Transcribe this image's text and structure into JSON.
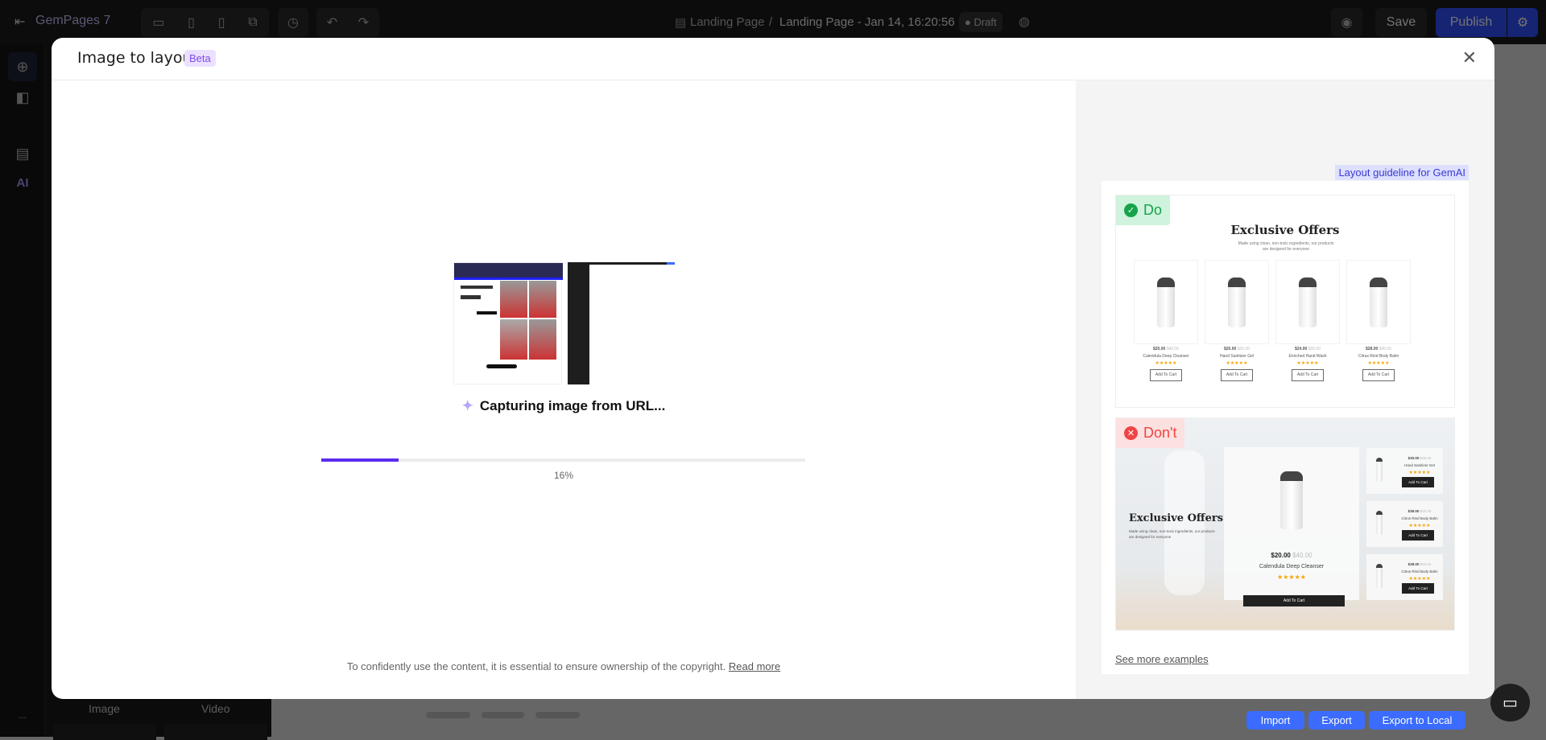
{
  "topbar": {
    "app_name": "GemPages 7",
    "breadcrumb_parent": "Landing Page",
    "breadcrumb_sep": "/",
    "page_name": "Landing Page - Jan 14, 16:20:56",
    "status": "Draft",
    "save": "Save",
    "publish": "Publish"
  },
  "sidebar": {
    "ai_label": "AI",
    "more": "..."
  },
  "leftpanel": {
    "items": [
      "Image",
      "Video"
    ]
  },
  "bottom": {
    "import": "Import",
    "export": "Export",
    "export_local": "Export to Local"
  },
  "modal": {
    "title": "Image to layout",
    "badge": "Beta",
    "status": "Capturing image from URL...",
    "progress_percent": 16,
    "progress_label": "16%",
    "footer_text": "To confidently use the content, it is essential to ensure ownership of the copyright.",
    "footer_link": "Read more",
    "guide": {
      "label": "Layout guideline for GemAI",
      "do": "Do",
      "dont": "Don't",
      "see_more": "See more examples",
      "do_example": {
        "heading": "Exclusive Offers",
        "sub": "Made using clean, non-toxic ingredients, our products are designed for everyone",
        "products": [
          {
            "price": "$20.00",
            "old": "$40.00",
            "name": "Calendula Deep Cleanser"
          },
          {
            "price": "$20.00",
            "old": "$25.00",
            "name": "Hand Sanitizer Gel"
          },
          {
            "price": "$24.00",
            "old": "$30.00",
            "name": "Enriched Hand Wash"
          },
          {
            "price": "$28.00",
            "old": "$45.00",
            "name": "Citrus Rind Body Balm"
          }
        ],
        "stars": "★★★★★",
        "cta": "Add To Cart"
      },
      "dont_example": {
        "heading": "Exclusive Offers",
        "sub": "Made using clean, non-toxic ingredients, our products are designed for everyone",
        "price": "$20.00",
        "old": "$40.00",
        "name": "Calendula Deep Cleanser",
        "stars": "★★★★★",
        "cta": "Add To Cart",
        "side": [
          {
            "price": "$30.00",
            "old": "$38.00",
            "name": "Hand Sanitizer Gel"
          },
          {
            "price": "$38.00",
            "old": "$45.00",
            "name": "Citrus Rind Body Balm"
          },
          {
            "price": "$38.00",
            "old": "$45.00",
            "name": "Citrus Rind Body Balm"
          }
        ]
      }
    }
  },
  "colors": {
    "accent": "#5b2bf0",
    "publish": "#2f4fff",
    "do": "#16a34a",
    "dont": "#ef4444",
    "bottom_btn": "#3b6cff"
  }
}
